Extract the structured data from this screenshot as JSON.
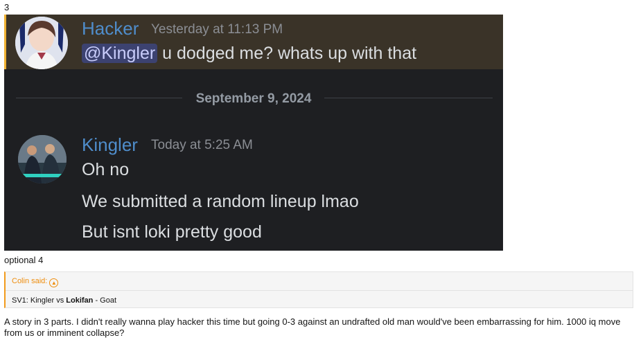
{
  "labels": {
    "top": "3",
    "middle": "optional 4"
  },
  "chat": {
    "message1": {
      "username": "Hacker",
      "timestamp": "Yesterday at 11:13 PM",
      "mention": "@Kingler",
      "text": " u dodged me? whats up with that"
    },
    "date_divider": "September 9, 2024",
    "message2": {
      "username": "Kingler",
      "timestamp": "Today at 5:25 AM",
      "lines": [
        "Oh no",
        "We submitted a random lineup lmao",
        "But isnt loki pretty good"
      ]
    },
    "colors": {
      "background": "#1e1f22",
      "highlight": "#3a3328",
      "highlight_bar": "#f0b232",
      "username": "#4f8dcb",
      "mention_bg": "#3c4270"
    }
  },
  "quote": {
    "author": "Colin said:",
    "arrow_icon": "circle-up-arrow-icon",
    "prefix": "SV1: Kingler vs ",
    "bold": "Lokifan",
    "suffix": " - Goat",
    "accent": "#f29b1c"
  },
  "post": {
    "text": "A story in 3 parts. I didn't really wanna play hacker this time but going 0-3 against an undrafted old man would've been embarrassing for him. 1000 iq move from us or imminent collapse?"
  }
}
